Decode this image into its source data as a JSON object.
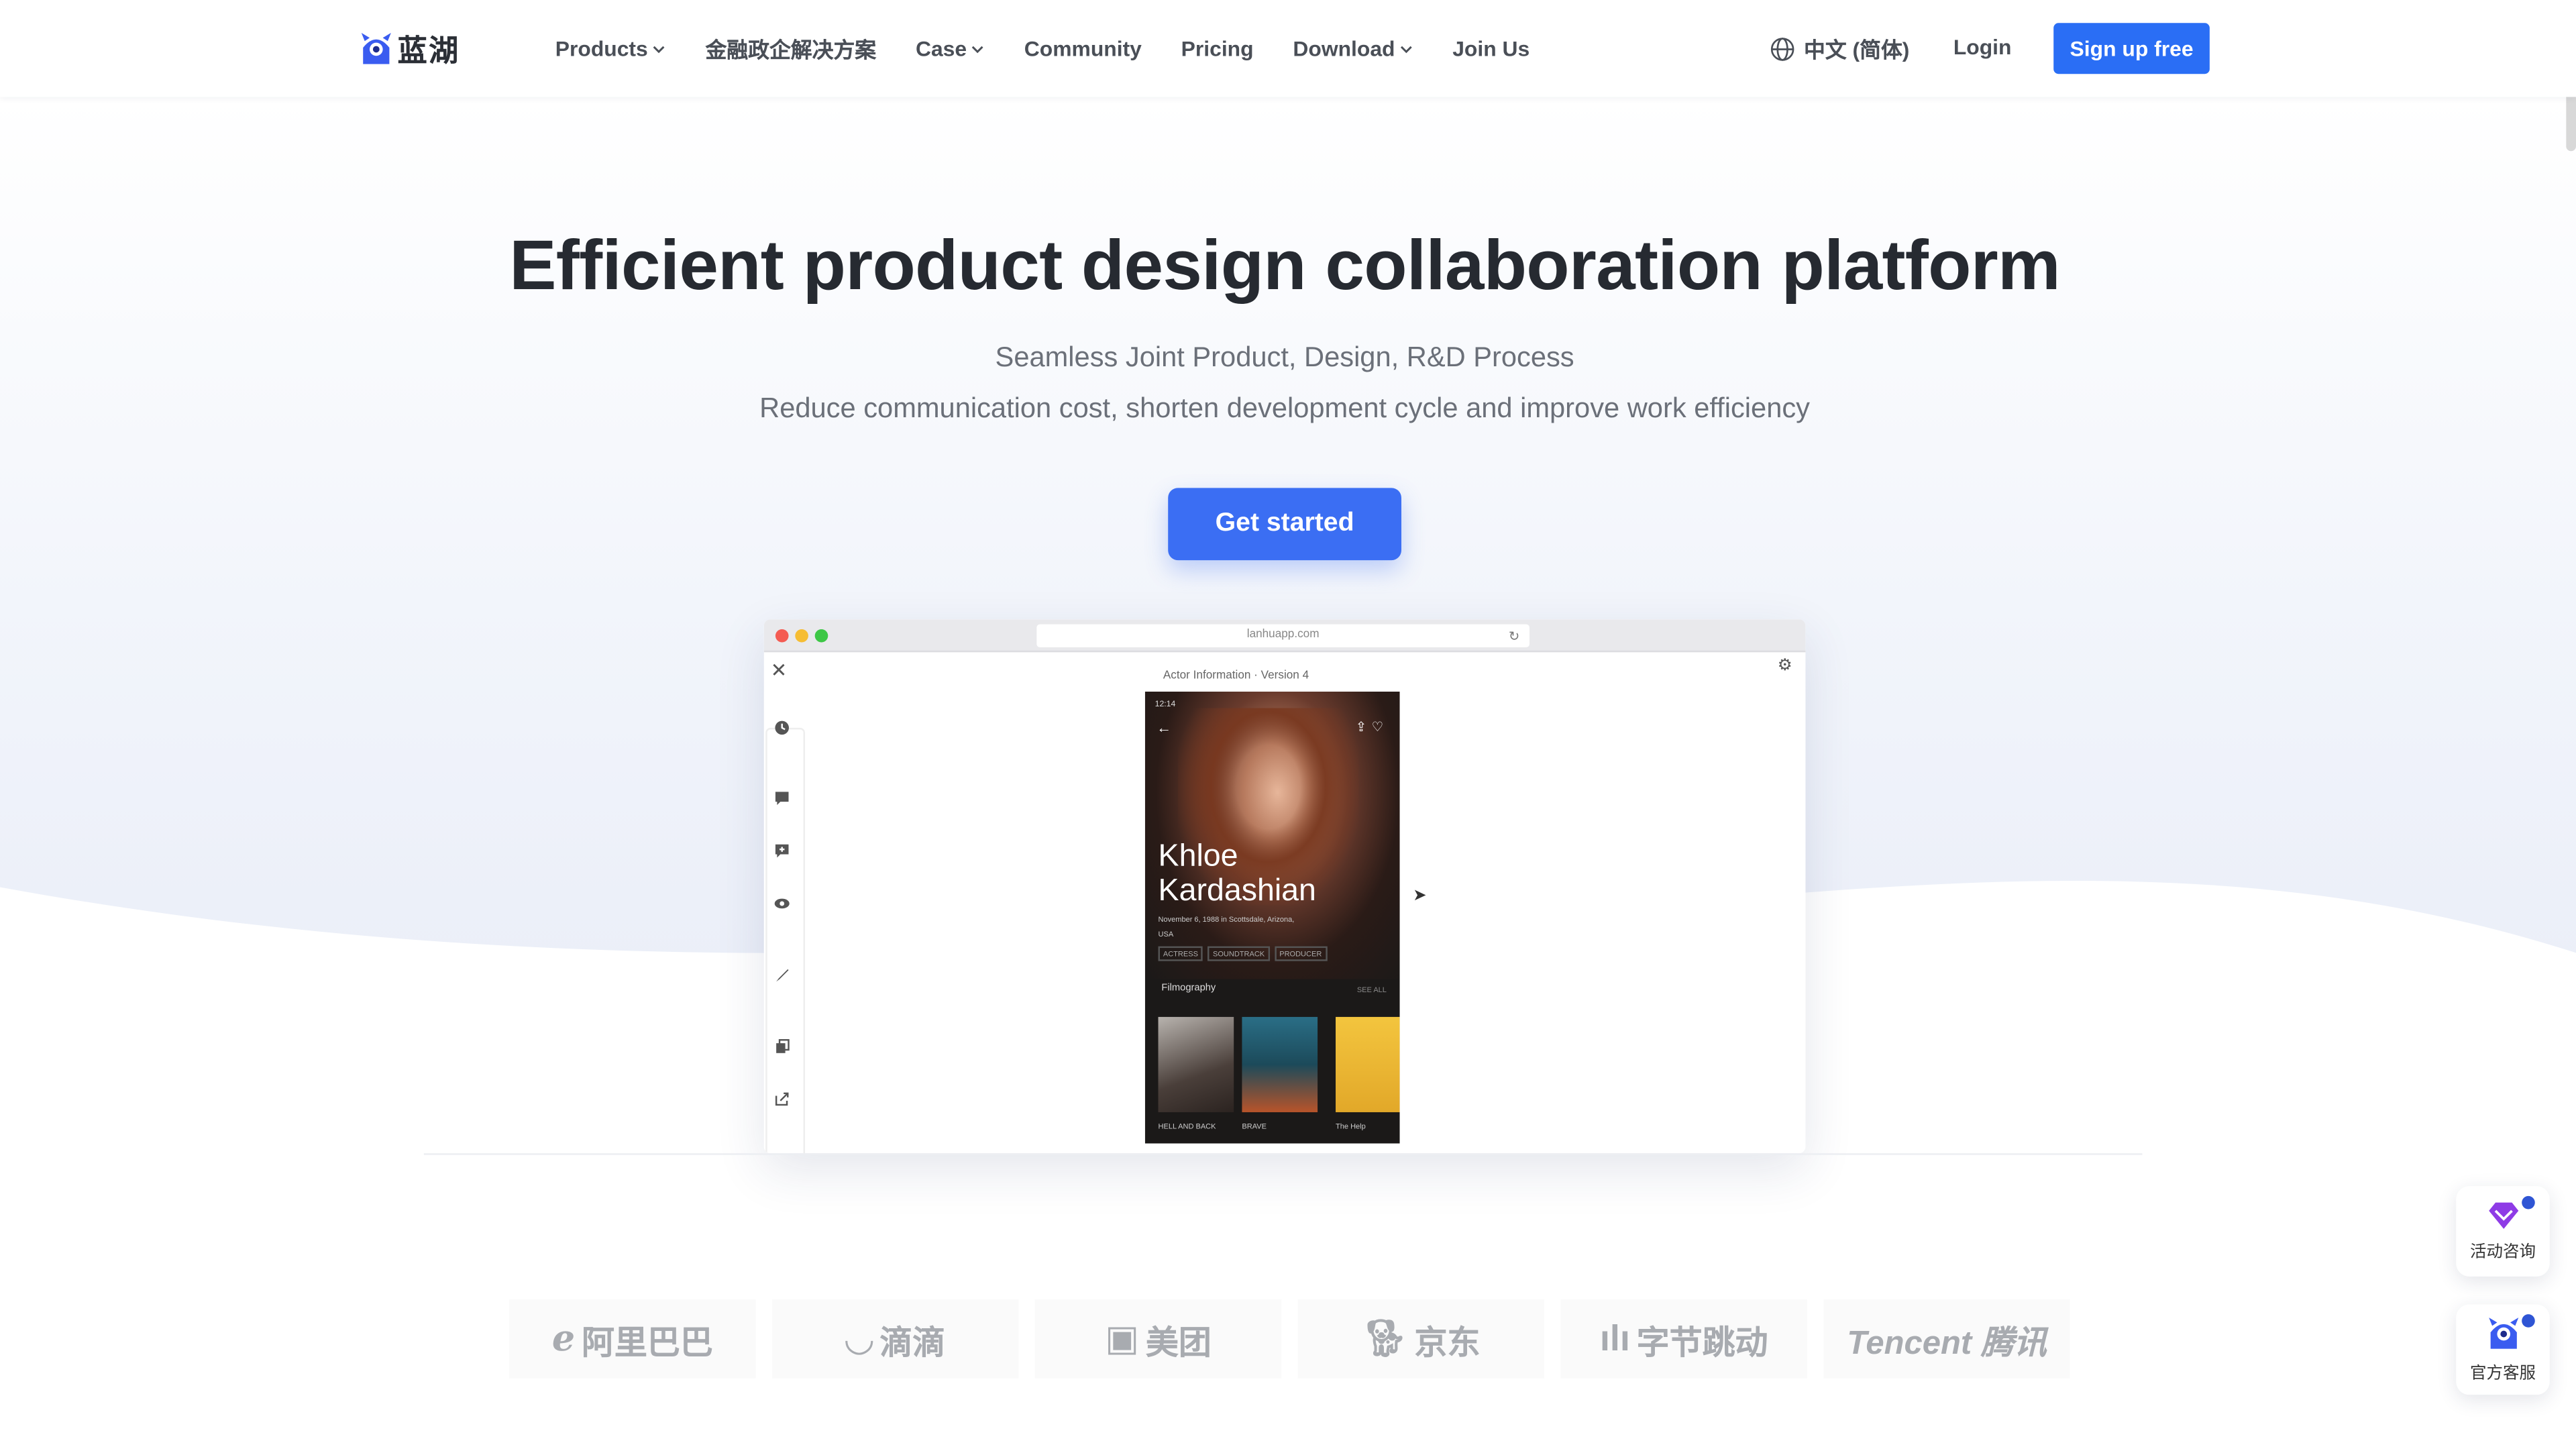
{
  "brand": {
    "logo_text": "蓝湖"
  },
  "nav": {
    "items": [
      {
        "label": "Products",
        "dropdown": true
      },
      {
        "label": "金融政企解决方案",
        "dropdown": false
      },
      {
        "label": "Case",
        "dropdown": true
      },
      {
        "label": "Community",
        "dropdown": false
      },
      {
        "label": "Pricing",
        "dropdown": false
      },
      {
        "label": "Download",
        "dropdown": true
      },
      {
        "label": "Join Us",
        "dropdown": false
      }
    ],
    "language": "中文 (简体)",
    "login": "Login",
    "signup": "Sign up free"
  },
  "hero": {
    "title": "Efficient product design collaboration platform",
    "subtitle_1": "Seamless Joint Product, Design, R&D Process",
    "subtitle_2": "Reduce communication cost, shorten development cycle and improve work efficiency",
    "cta": "Get started"
  },
  "mock_browser": {
    "url": "lanhuapp.com",
    "version_label": "Actor Information · Version 4",
    "phone": {
      "time": "12:14",
      "name_line1": "Khloe",
      "name_line2": "Kardashian",
      "birth": "November 6, 1988 in Scottsdale, Arizona, USA",
      "tags": [
        "ACTRESS",
        "SOUNDTRACK",
        "PRODUCER"
      ],
      "section": "Filmography",
      "see_all": "SEE ALL",
      "films": [
        "HELL AND BACK",
        "BRAVE",
        "The Help"
      ]
    }
  },
  "brands": [
    {
      "name": "阿里巴巴",
      "icon": "alibaba-icon"
    },
    {
      "name": "滴滴",
      "icon": "didi-icon"
    },
    {
      "name": "美团",
      "icon": "meituan-icon"
    },
    {
      "name": "京东",
      "icon": "jd-icon"
    },
    {
      "name": "字节跳动",
      "icon": "bytedance-icon"
    },
    {
      "name": "Tencent 腾讯",
      "icon": "tencent-icon"
    }
  ],
  "widgets": [
    {
      "label": "活动咨询",
      "icon": "gem-icon"
    },
    {
      "label": "官方客服",
      "icon": "mascot-icon"
    }
  ],
  "colors": {
    "accent": "#2a6ef5",
    "cta": "#3b6ef3",
    "title": "#262a31"
  }
}
